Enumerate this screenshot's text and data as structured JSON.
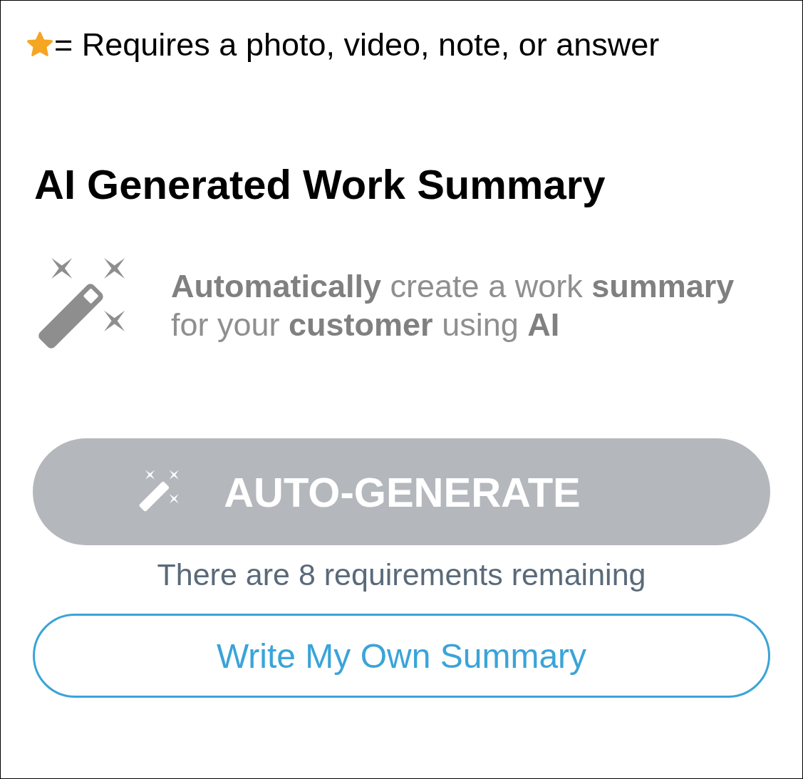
{
  "legend": {
    "text": "= Requires a photo, video, note, or answer"
  },
  "section": {
    "title": "AI Generated Work Summary",
    "description": "**Automatically** create a work **summary** for your **customer** using **AI**"
  },
  "auto_generate_button": {
    "label": "AUTO-GENERATE",
    "disabled": true
  },
  "remaining_note": "There are 8 requirements remaining",
  "write_button": {
    "label": "Write My Own Summary"
  }
}
